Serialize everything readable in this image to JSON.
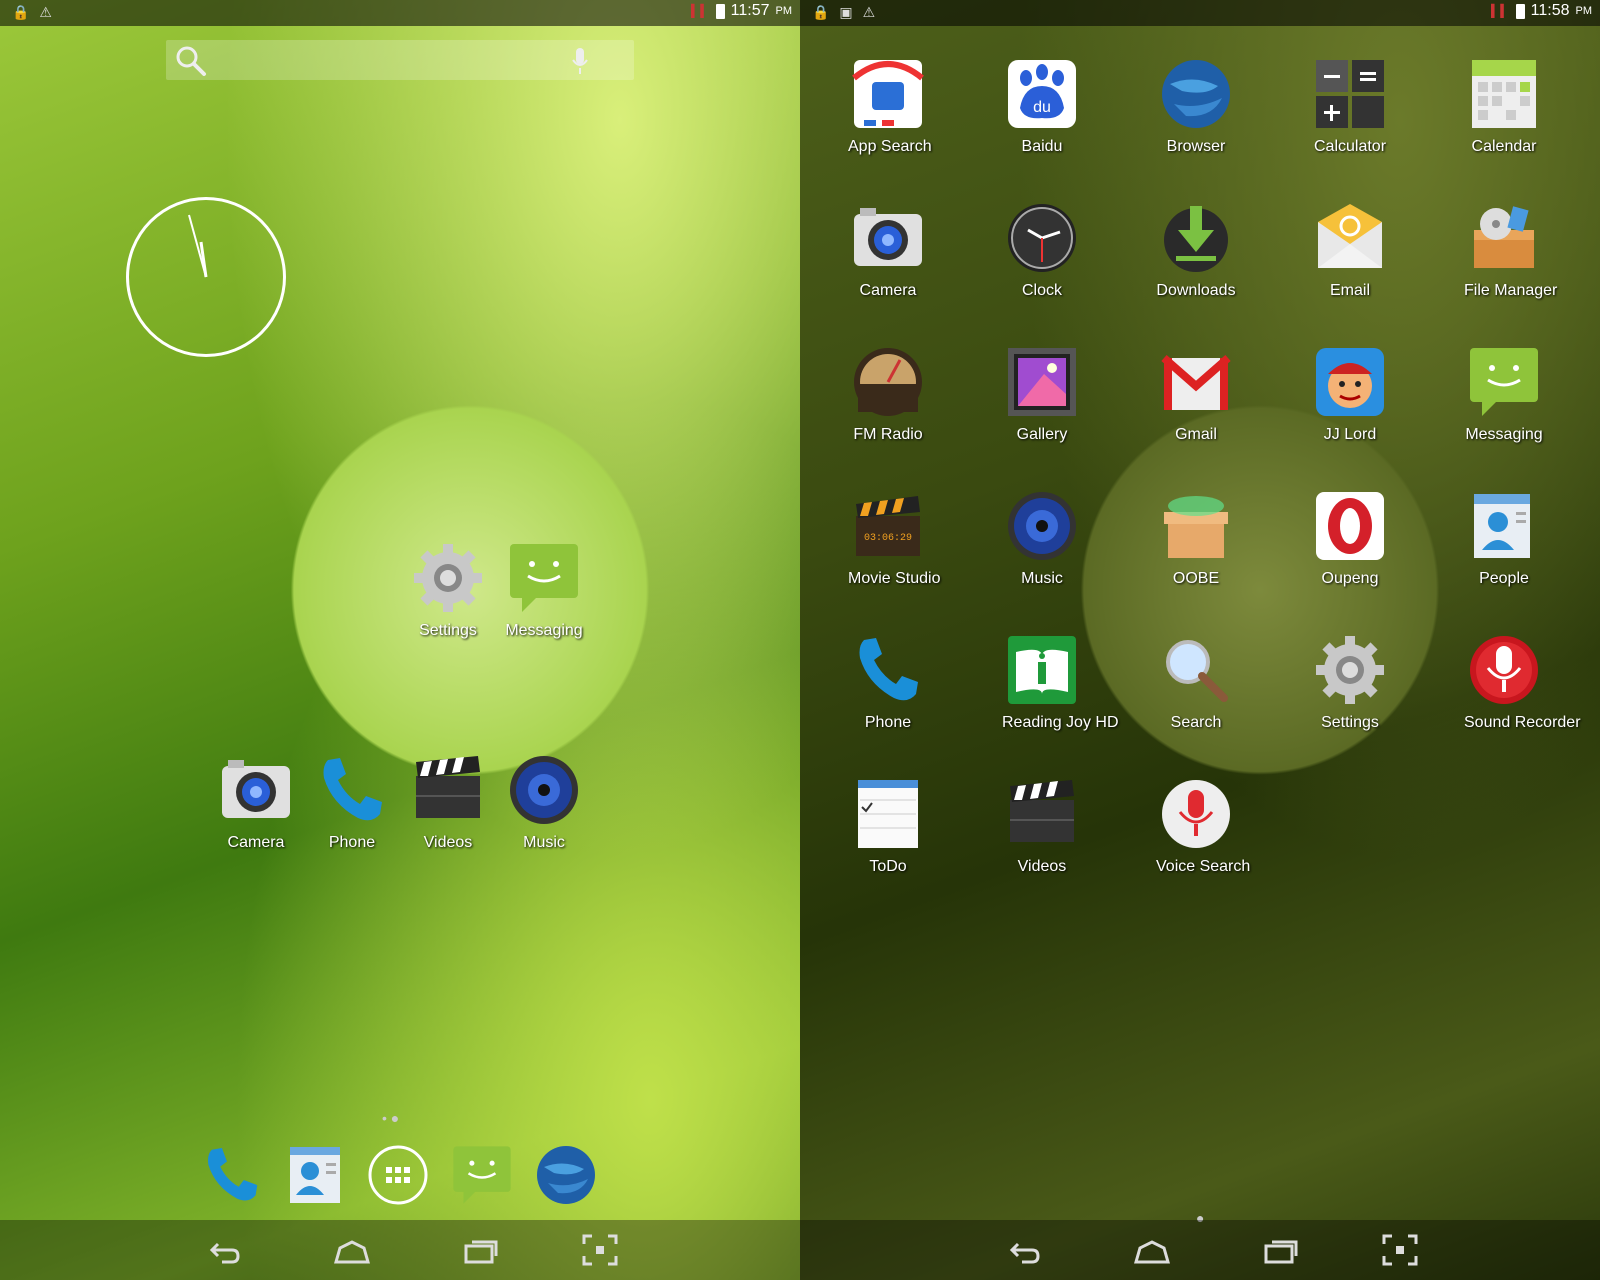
{
  "left_screen": {
    "status": {
      "time": "11:57",
      "ampm": "PM"
    },
    "home_icons": [
      {
        "label": "Settings",
        "icon": "settings-icon"
      },
      {
        "label": "Messaging",
        "icon": "messaging-icon"
      },
      {
        "label": "Camera",
        "icon": "camera-icon"
      },
      {
        "label": "Phone",
        "icon": "phone-icon"
      },
      {
        "label": "Videos",
        "icon": "videos-icon"
      },
      {
        "label": "Music",
        "icon": "music-icon"
      }
    ],
    "dock": [
      "phone-icon",
      "people-icon",
      "all-apps-icon",
      "messaging-icon",
      "browser-icon"
    ]
  },
  "right_screen": {
    "status": {
      "time": "11:58",
      "ampm": "PM"
    },
    "apps": [
      {
        "label": "App Search",
        "icon": "app-search-icon"
      },
      {
        "label": "Baidu",
        "icon": "baidu-icon"
      },
      {
        "label": "Browser",
        "icon": "browser-icon"
      },
      {
        "label": "Calculator",
        "icon": "calculator-icon"
      },
      {
        "label": "Calendar",
        "icon": "calendar-icon"
      },
      {
        "label": "Camera",
        "icon": "camera-icon"
      },
      {
        "label": "Clock",
        "icon": "clock-icon"
      },
      {
        "label": "Downloads",
        "icon": "downloads-icon"
      },
      {
        "label": "Email",
        "icon": "email-icon"
      },
      {
        "label": "File Manager",
        "icon": "file-manager-icon"
      },
      {
        "label": "FM Radio",
        "icon": "fm-radio-icon"
      },
      {
        "label": "Gallery",
        "icon": "gallery-icon"
      },
      {
        "label": "Gmail",
        "icon": "gmail-icon"
      },
      {
        "label": "JJ Lord",
        "icon": "jj-lord-icon"
      },
      {
        "label": "Messaging",
        "icon": "messaging-icon"
      },
      {
        "label": "Movie Studio",
        "icon": "movie-studio-icon"
      },
      {
        "label": "Music",
        "icon": "music-icon"
      },
      {
        "label": "OOBE",
        "icon": "oobe-icon"
      },
      {
        "label": "Oupeng",
        "icon": "oupeng-icon"
      },
      {
        "label": "People",
        "icon": "people-icon"
      },
      {
        "label": "Phone",
        "icon": "phone-icon"
      },
      {
        "label": "Reading Joy HD",
        "icon": "reading-joy-icon"
      },
      {
        "label": "Search",
        "icon": "search-icon"
      },
      {
        "label": "Settings",
        "icon": "settings-icon"
      },
      {
        "label": "Sound Recorder",
        "icon": "sound-recorder-icon"
      },
      {
        "label": "ToDo",
        "icon": "todo-icon"
      },
      {
        "label": "Videos",
        "icon": "videos-icon"
      },
      {
        "label": "Voice Search",
        "icon": "voice-search-icon"
      }
    ]
  },
  "colors": {
    "accent_blue": "#1a8fd8",
    "messaging_green": "#8fc43a",
    "oupeng_red": "#d4202a"
  }
}
